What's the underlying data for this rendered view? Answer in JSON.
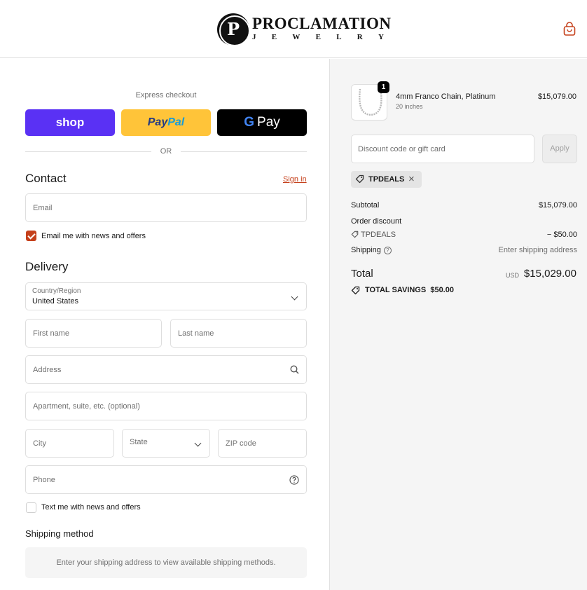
{
  "brand": {
    "mark": "P",
    "name": "PROCLAMATION",
    "subtitle_letters": [
      "J",
      "E",
      "W",
      "E",
      "L",
      "R",
      "Y"
    ]
  },
  "express": {
    "title": "Express checkout",
    "shop_label": "shop",
    "paypal_a": "Pay",
    "paypal_b": "Pal",
    "gpay_g": [
      "G"
    ],
    "gpay_label": "Pay",
    "or": "OR"
  },
  "contact": {
    "title": "Contact",
    "signin": "Sign in",
    "email_placeholder": "Email",
    "newsletter_label": "Email me with news and offers",
    "newsletter_checked": true
  },
  "delivery": {
    "title": "Delivery",
    "country_label": "Country/Region",
    "country_value": "United States",
    "first_name": "First name",
    "last_name": "Last name",
    "address": "Address",
    "apartment": "Apartment, suite, etc. (optional)",
    "city": "City",
    "state": "State",
    "zip": "ZIP code",
    "phone": "Phone",
    "sms_label": "Text me with news and offers",
    "sms_checked": false
  },
  "shipping_method": {
    "title": "Shipping method",
    "message": "Enter your shipping address to view available shipping methods."
  },
  "order": {
    "item": {
      "quantity": "1",
      "name": "4mm Franco Chain, Platinum",
      "variant": "20 inches",
      "price": "$15,079.00"
    },
    "discount_placeholder": "Discount code or gift card",
    "apply_label": "Apply",
    "applied_code": "TPDEALS",
    "subtotal_label": "Subtotal",
    "subtotal_value": "$15,079.00",
    "order_discount_label": "Order discount",
    "discount_code": "TPDEALS",
    "discount_value": "− $50.00",
    "shipping_label": "Shipping",
    "shipping_value": "Enter shipping address",
    "total_label": "Total",
    "currency": "USD",
    "total_value": "$15,029.00",
    "savings_label": "TOTAL SAVINGS",
    "savings_value": "$50.00"
  },
  "colors": {
    "accent": "#c5401b",
    "shop_pay": "#5a31f4",
    "paypal": "#ffc439",
    "gpay": "#000000"
  }
}
